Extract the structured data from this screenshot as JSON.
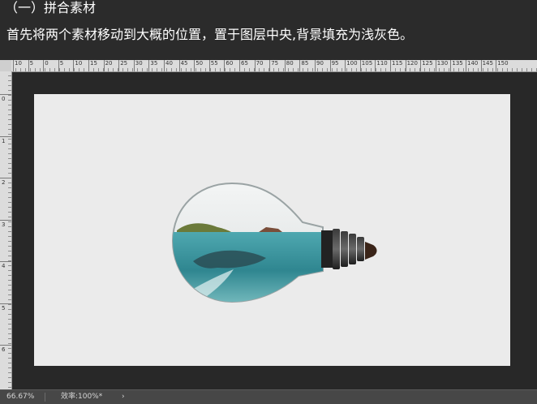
{
  "header": {
    "title": "（一）拼合素材",
    "subtitle": "首先将两个素材移动到大概的位置，置于图层中央,背景填充为浅灰色。"
  },
  "ruler_top": {
    "labels": [
      "10",
      "5",
      "0",
      "5",
      "10",
      "15",
      "20",
      "25",
      "30",
      "35",
      "40",
      "45",
      "50",
      "55",
      "60",
      "65",
      "70",
      "75",
      "80",
      "85",
      "90",
      "95",
      "100",
      "105",
      "110",
      "115",
      "120",
      "125",
      "130",
      "135",
      "140",
      "145",
      "150"
    ]
  },
  "ruler_left": {
    "labels": [
      "0",
      "1",
      "2",
      "3",
      "4",
      "5",
      "6"
    ]
  },
  "status": {
    "zoom": "66.67%",
    "efficiency_label": "效率:",
    "efficiency_value": "100%*",
    "arrow": "›"
  },
  "colors": {
    "canvas": "#ebebeb",
    "pasteboard": "#282828",
    "water": "#3b8f98"
  }
}
